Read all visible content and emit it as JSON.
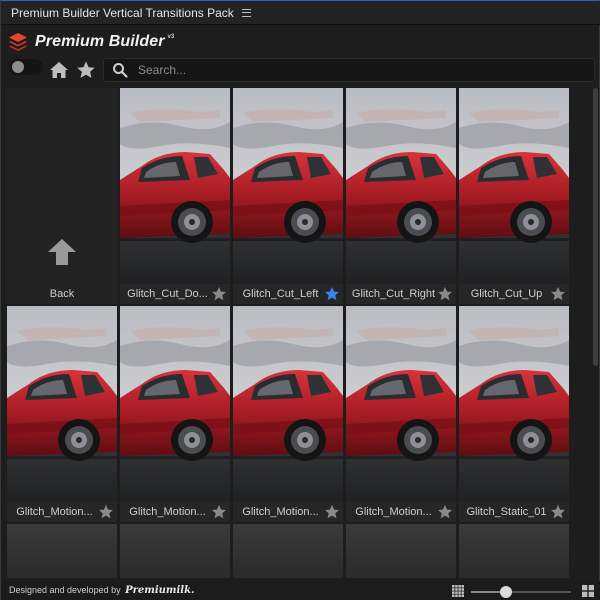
{
  "window": {
    "title": "Premium Builder Vertical Transitions Pack"
  },
  "brand": {
    "name": "Premium Builder",
    "version": "v3",
    "logo_color": "#e8442f"
  },
  "toolbar": {
    "toggle_on": false,
    "search_placeholder": "Search..."
  },
  "back": {
    "label": "Back"
  },
  "items": [
    {
      "label": "Glitch_Cut_Do...",
      "favorite": false
    },
    {
      "label": "Glitch_Cut_Left",
      "favorite": true
    },
    {
      "label": "Glitch_Cut_Right",
      "favorite": false
    },
    {
      "label": "Glitch_Cut_Up",
      "favorite": false
    },
    {
      "label": "Glitch_Motion...",
      "favorite": false
    },
    {
      "label": "Glitch_Motion...",
      "favorite": false
    },
    {
      "label": "Glitch_Motion...",
      "favorite": false
    },
    {
      "label": "Glitch_Motion...",
      "favorite": false
    },
    {
      "label": "Glitch_Static_01",
      "favorite": false
    }
  ],
  "colors": {
    "star_active": "#3a82f0",
    "star_inactive": "#8a8a8a"
  },
  "footer": {
    "credit_text": "Designed and developed by",
    "credit_brand": "Premiumilk.",
    "thumbnail_size": 0.35
  }
}
